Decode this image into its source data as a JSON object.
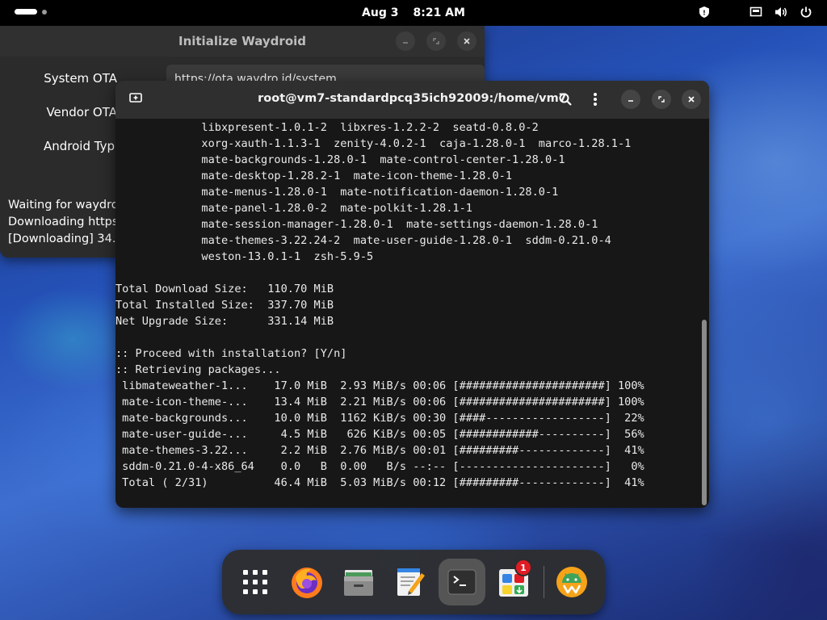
{
  "topbar": {
    "date": "Aug 3",
    "time": "8:21 AM"
  },
  "waydroid_window": {
    "title": "Initialize Waydroid",
    "labels": {
      "system_ota": "System OTA",
      "vendor_ota": "Vendor OTA",
      "android_type": "Android Typ"
    },
    "system_ota_value": "https://ota.waydro.id/system",
    "log": [
      "Waiting for waydro",
      "Downloading https",
      "[Downloading] 34."
    ]
  },
  "terminal": {
    "title": "root@vm7-standardpcq35ich92009:/home/vm7",
    "lines": [
      "             libxpresent-1.0.1-2  libxres-1.2.2-2  seatd-0.8.0-2",
      "             xorg-xauth-1.1.3-1  zenity-4.0.2-1  caja-1.28.0-1  marco-1.28.1-1",
      "             mate-backgrounds-1.28.0-1  mate-control-center-1.28.0-1",
      "             mate-desktop-1.28.2-1  mate-icon-theme-1.28.0-1",
      "             mate-menus-1.28.0-1  mate-notification-daemon-1.28.0-1",
      "             mate-panel-1.28.0-2  mate-polkit-1.28.1-1",
      "             mate-session-manager-1.28.0-1  mate-settings-daemon-1.28.0-1",
      "             mate-themes-3.22.24-2  mate-user-guide-1.28.0-1  sddm-0.21.0-4",
      "             weston-13.0.1-1  zsh-5.9-5",
      "",
      "Total Download Size:   110.70 MiB",
      "Total Installed Size:  337.70 MiB",
      "Net Upgrade Size:      331.14 MiB",
      "",
      ":: Proceed with installation? [Y/n]",
      ":: Retrieving packages...",
      " libmateweather-1...    17.0 MiB  2.93 MiB/s 00:06 [######################] 100%",
      " mate-icon-theme-...    13.4 MiB  2.21 MiB/s 00:06 [######################] 100%",
      " mate-backgrounds...    10.0 MiB  1162 KiB/s 00:30 [####------------------]  22%",
      " mate-user-guide-...     4.5 MiB   626 KiB/s 00:05 [############----------]  56%",
      " mate-themes-3.22...     2.2 MiB  2.76 MiB/s 00:01 [#########-------------]  41%",
      " sddm-0.21.0-4-x86_64    0.0   B  0.00   B/s --:-- [----------------------]   0%",
      " Total ( 2/31)          46.4 MiB  5.03 MiB/s 00:12 [#########-------------]  41%"
    ]
  },
  "dock": {
    "software_badge": "1"
  }
}
